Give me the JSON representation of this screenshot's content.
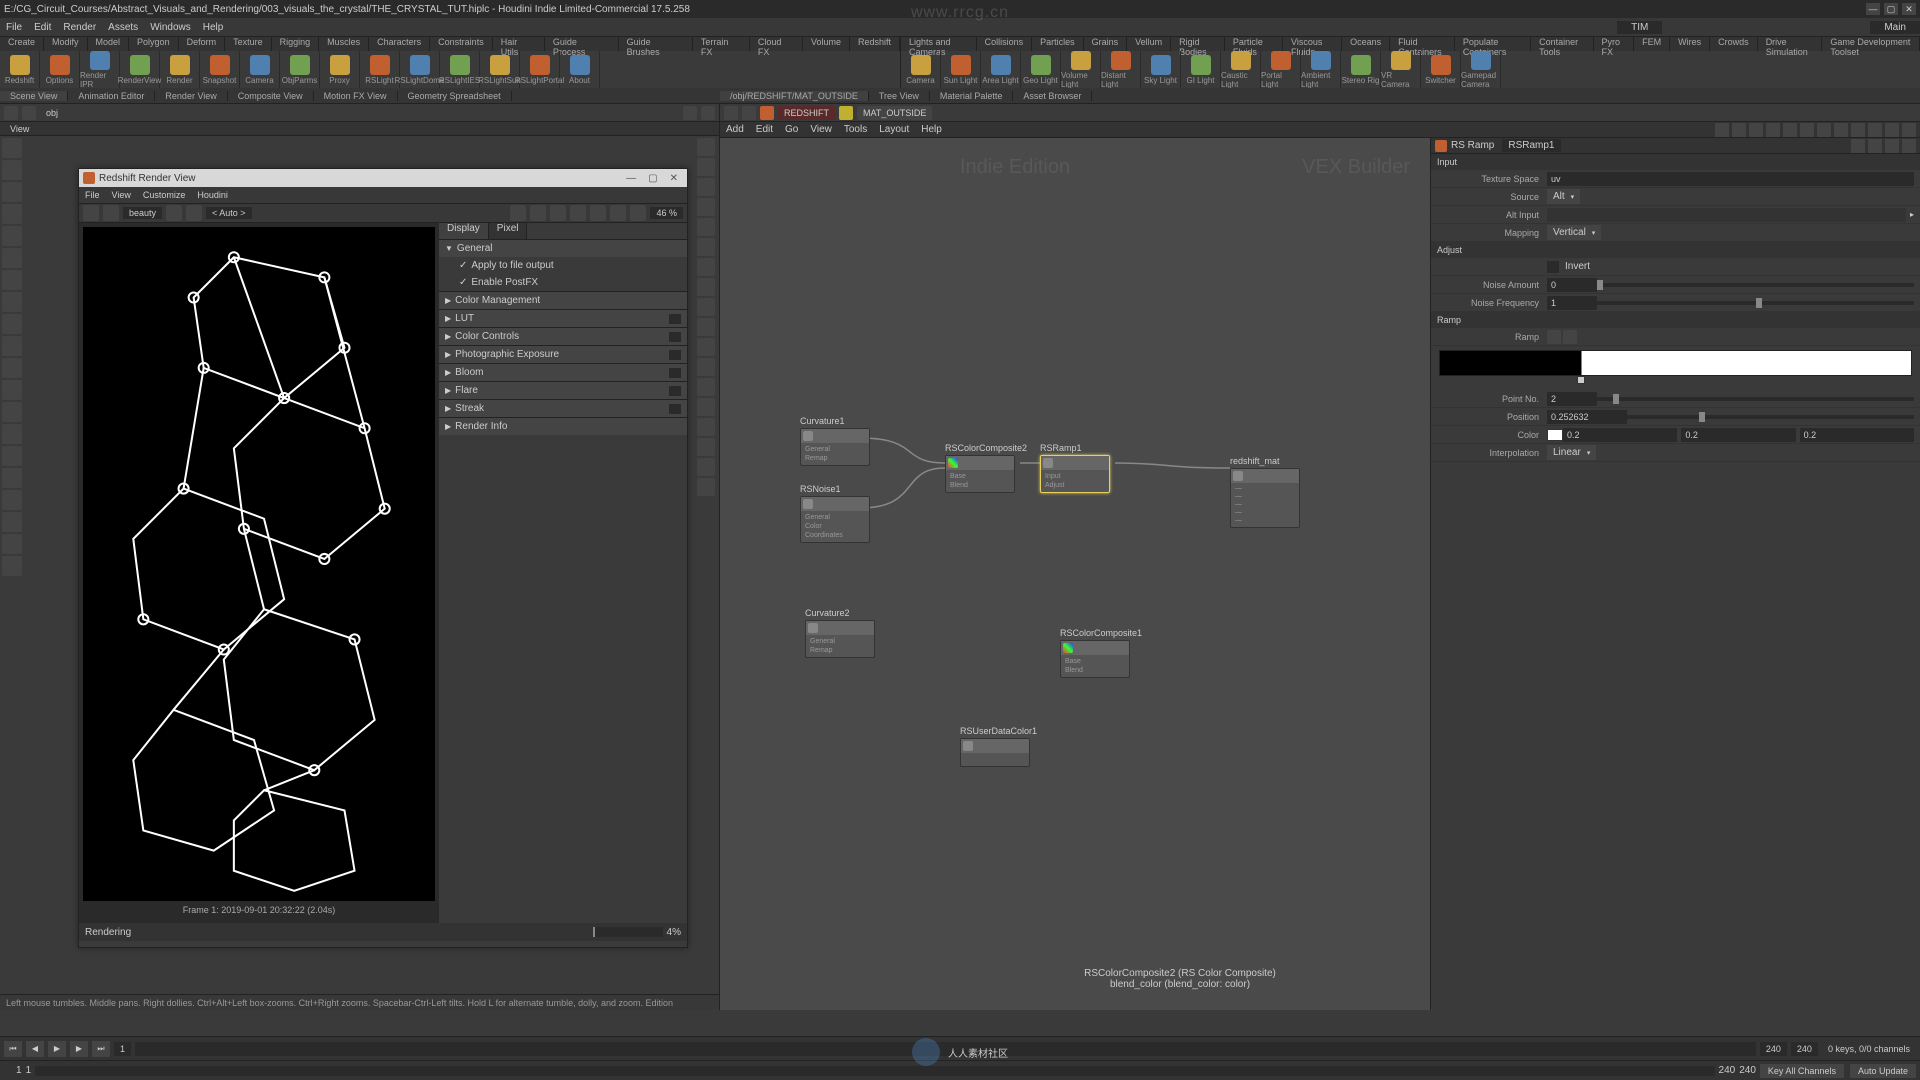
{
  "window": {
    "title": "E:/CG_Circuit_Courses/Abstract_Visuals_and_Rendering/003_visuals_the_crystal/THE_CRYSTAL_TUT.hiplc - Houdini Indie Limited-Commercial 17.5.258",
    "minimize": "—",
    "maximize": "▢",
    "close": "✕"
  },
  "menubar": [
    "File",
    "Edit",
    "Render",
    "Assets",
    "Windows",
    "Help"
  ],
  "desktop_label": "TIM",
  "main_label": "Main",
  "shelf_left_tabs": [
    "Create",
    "Modify",
    "Model",
    "Polygon",
    "Deform",
    "Texture",
    "Rigging",
    "Muscles",
    "Characters",
    "Constraints",
    "Hair Utils",
    "Guide Process",
    "Guide Brushes",
    "Terrain FX",
    "Cloud FX",
    "Volume",
    "Redshift"
  ],
  "shelf_left_tools": [
    "Redshift",
    "Options",
    "Render IPR",
    "RenderView",
    "Render",
    "Snapshot",
    "Camera",
    "ObjParms",
    "Proxy",
    "RSLight",
    "RSLightDome",
    "RSLightIES",
    "RSLightSun",
    "RSLightPortal",
    "About"
  ],
  "shelf_right_tabs": [
    "Lights and Cameras",
    "Collisions",
    "Particles",
    "Grains",
    "Vellum",
    "Rigid Bodies",
    "Particle Fluids",
    "Viscous Fluids",
    "Oceans",
    "Fluid Containers",
    "Populate Containers",
    "Container Tools",
    "Pyro FX",
    "FEM",
    "Wires",
    "Crowds",
    "Drive Simulation",
    "Game Development Toolset"
  ],
  "shelf_right_tools": [
    "Camera",
    "Sun Light",
    "Area Light",
    "Geo Light",
    "Volume Light",
    "Distant Light",
    "Sky Light",
    "GI Light",
    "Caustic Light",
    "Portal Light",
    "Ambient Light",
    "Stereo Rig",
    "VR Camera",
    "Switcher",
    "Gamepad Camera"
  ],
  "pane_tabs_left": [
    "Scene View",
    "Animation Editor",
    "Render View",
    "Composite View",
    "Motion FX View",
    "Geometry Spreadsheet"
  ],
  "left_path": "obj",
  "view_label": "View",
  "render_view": {
    "title": "Redshift Render View",
    "menu": [
      "File",
      "View",
      "Customize",
      "Houdini"
    ],
    "aov": "beauty",
    "auto": "< Auto >",
    "zoom": "46 %",
    "tabs": [
      "Display",
      "Pixel"
    ],
    "sections": [
      "General",
      "Color Management",
      "LUT",
      "Color Controls",
      "Photographic Exposure",
      "Bloom",
      "Flare",
      "Streak",
      "Render Info"
    ],
    "checks": [
      "Apply to file output",
      "Enable PostFX"
    ],
    "frame_info": "Frame  1:  2019-09-01  20:32:22   (2.04s)",
    "status": "Rendering",
    "progress": "4%"
  },
  "hint": "Left mouse tumbles. Middle pans. Right dollies. Ctrl+Alt+Left box-zooms. Ctrl+Right zooms. Spacebar-Ctrl-Left tilts. Hold L for alternate tumble, dolly, and zoom.   Edition",
  "ne_tabs": [
    "/obj/REDSHIFT/MAT_OUTSIDE",
    "Tree View",
    "Material Palette",
    "Asset Browser"
  ],
  "ne_path": {
    "redshift": "REDSHIFT",
    "mat": "MAT_OUTSIDE"
  },
  "ne_menu": [
    "Add",
    "Edit",
    "Go",
    "View",
    "Tools",
    "Layout",
    "Help"
  ],
  "wm_left": "Indie Edition",
  "wm_right": "VEX Builder",
  "nodes": {
    "curvature1": "Curvature1",
    "rsnoise1": "RSNoise1",
    "curvature2": "Curvature2",
    "rscolorcomposite2": "RSColorComposite2",
    "rsramp1": "RSRamp1",
    "rsuserdatacolor1": "RSUserDataColor1",
    "rscolorcomposite1": "RSColorComposite1",
    "redshift_mat": "redshift_mat"
  },
  "tooltip": {
    "line1": "RSColorComposite2 (RS Color Composite)",
    "line2": "blend_color (blend_color: color)"
  },
  "param": {
    "type": "RS Ramp",
    "name": "RSRamp1",
    "sections": {
      "input": "Input",
      "adjust": "Adjust",
      "ramp": "Ramp"
    },
    "labels": {
      "texture_space": "Texture Space",
      "source": "Source",
      "alt_input": "Alt Input",
      "mapping": "Mapping",
      "invert": "Invert",
      "noise_amount": "Noise Amount",
      "noise_freq": "Noise Frequency",
      "ramp": "Ramp",
      "point_no": "Point No.",
      "position": "Position",
      "color": "Color",
      "interpolation": "Interpolation"
    },
    "values": {
      "texture_space": "uv",
      "source": "Alt",
      "mapping": "Vertical",
      "noise_amount": "0",
      "noise_freq": "1",
      "point_no": "2",
      "position": "0.252632",
      "color_r": "0.2",
      "color_g": "0.2",
      "color_b": "0.2",
      "interpolation": "Linear"
    }
  },
  "timeline": {
    "frame": "1",
    "start": "1",
    "end": "240",
    "keys": "0 keys, 0/0 channels"
  },
  "statusbar": {
    "key_all": "Key All Channels",
    "auto_update": "Auto Update"
  },
  "watermark": {
    "url": "www.rrcg.cn",
    "text": "人人素材社区"
  }
}
